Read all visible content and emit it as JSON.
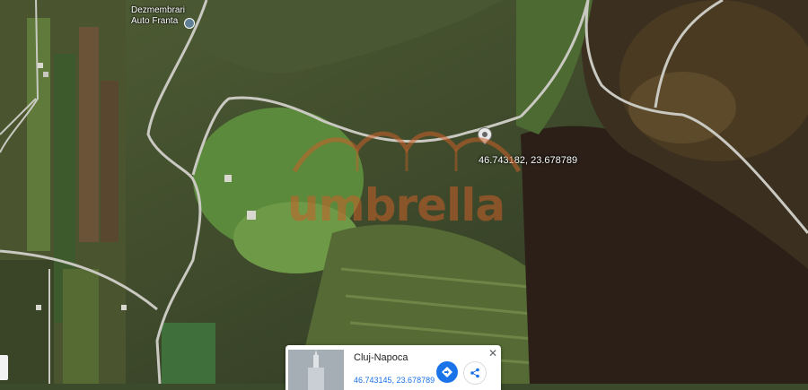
{
  "map": {
    "poi": {
      "label_line1": "Dezmembrari",
      "label_line2": "Auto Franta"
    },
    "pin_coordinates": "46.743182, 23.678789",
    "watermark_text": "umbrella"
  },
  "place_card": {
    "title": "Cluj-Napoca",
    "coordinates": "46.743145, 23.678789",
    "directions_icon": "directions-icon",
    "share_icon": "share-icon",
    "close_icon": "close-icon"
  },
  "colors": {
    "accent_blue": "#1a73e8",
    "watermark_orange": "#c85f28"
  }
}
